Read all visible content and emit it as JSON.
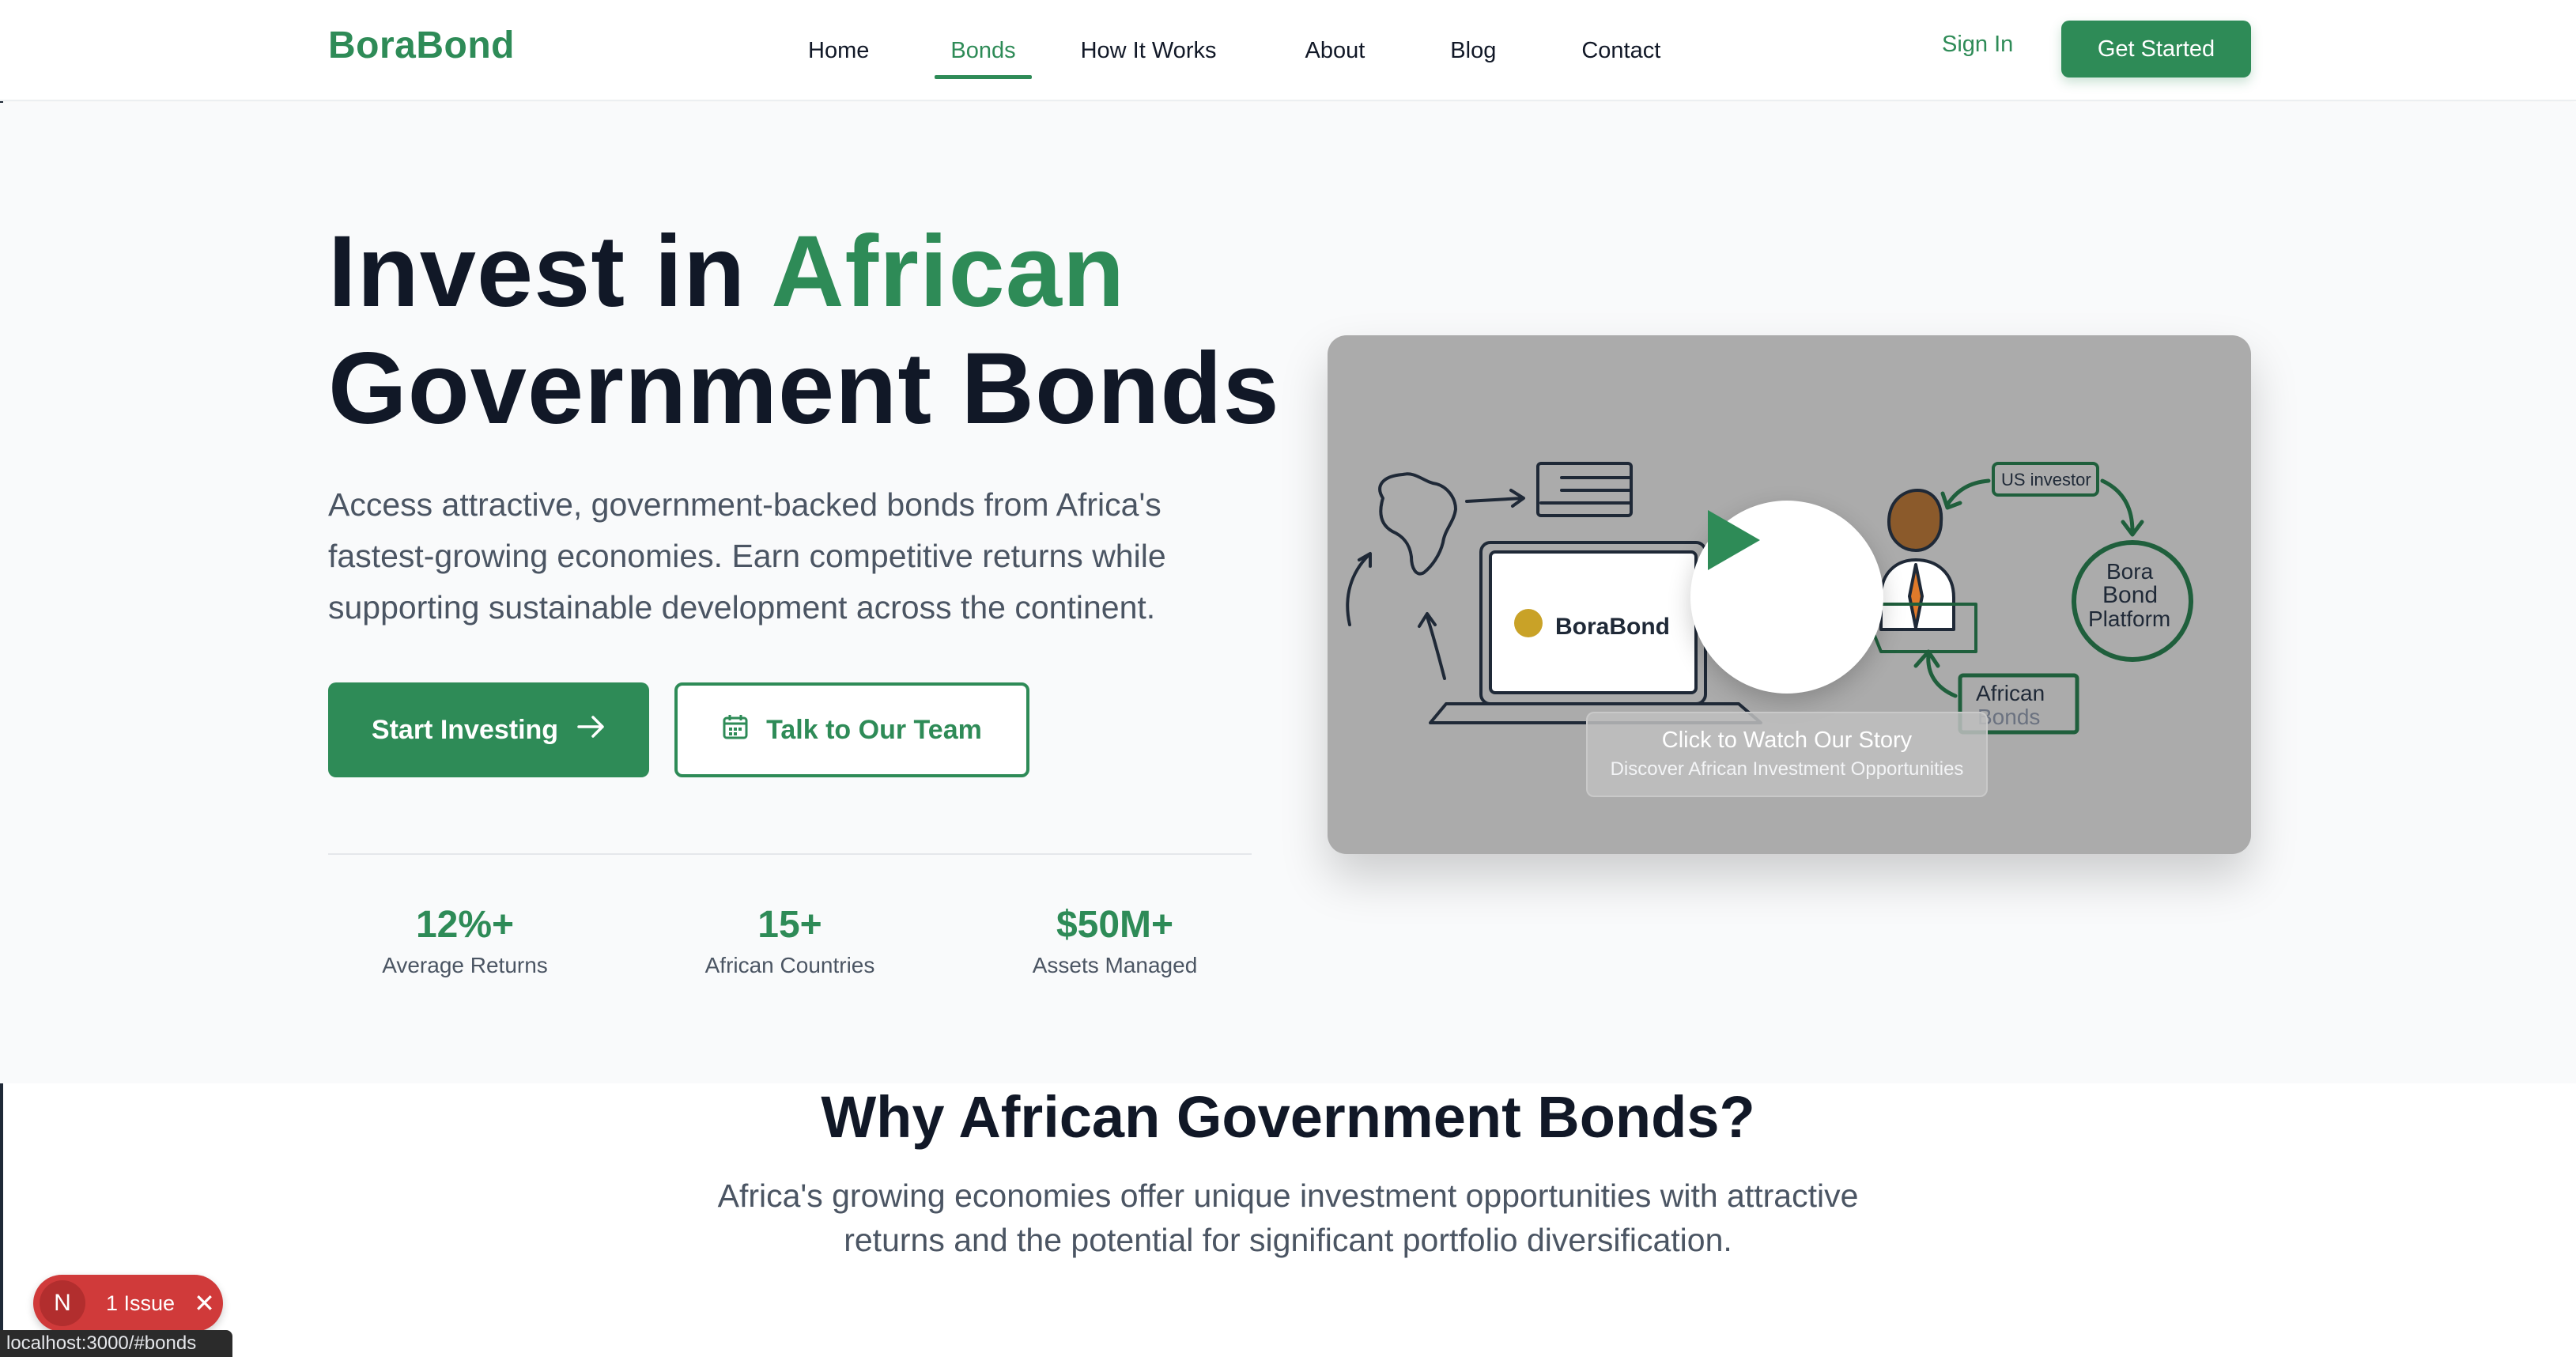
{
  "nav": {
    "logo": "BoraBond",
    "links": [
      {
        "label": "Home"
      },
      {
        "label": "Bonds",
        "active": true
      },
      {
        "label": "How It Works"
      },
      {
        "label": "About"
      },
      {
        "label": "Blog"
      },
      {
        "label": "Contact"
      }
    ],
    "sign_in": "Sign In",
    "get_started": "Get Started"
  },
  "hero": {
    "title_line1_a": "Invest in ",
    "title_line1_b": "African",
    "title_line2": "Government Bonds",
    "lead": "Access attractive, government-backed bonds from Africa's fastest-growing economies. Earn competitive returns while supporting sustainable development across the continent.",
    "start_investing": "Start Investing",
    "talk_team": "Talk to Our Team",
    "stats": [
      {
        "value": "12%+",
        "label": "Average Returns"
      },
      {
        "value": "15+",
        "label": "African Countries"
      },
      {
        "value": "$50M+",
        "label": "Assets Managed"
      }
    ]
  },
  "video": {
    "brand": "BoraBond",
    "us_investor": "US investor",
    "platform_line1": "Bora",
    "platform_line2": "Bond",
    "platform_line3": "Platform",
    "african_bonds_line1": "African",
    "african_bonds_line2": "Bonds",
    "caption_title": "Click to Watch Our Story",
    "caption_sub": "Discover African Investment Opportunities"
  },
  "why": {
    "title": "Why African Government Bonds?",
    "text": "Africa's growing economies offer unique investment opportunities with attractive returns and the potential for significant portfolio diversification."
  },
  "dev": {
    "badge_letter": "N",
    "issue_label": "1 Issue",
    "status_url": "localhost:3000/#bonds"
  },
  "colors": {
    "brand_green": "#2e8b57",
    "text_dark": "#111827",
    "text_muted": "#4b5563",
    "issue_red": "#d03a3a"
  }
}
